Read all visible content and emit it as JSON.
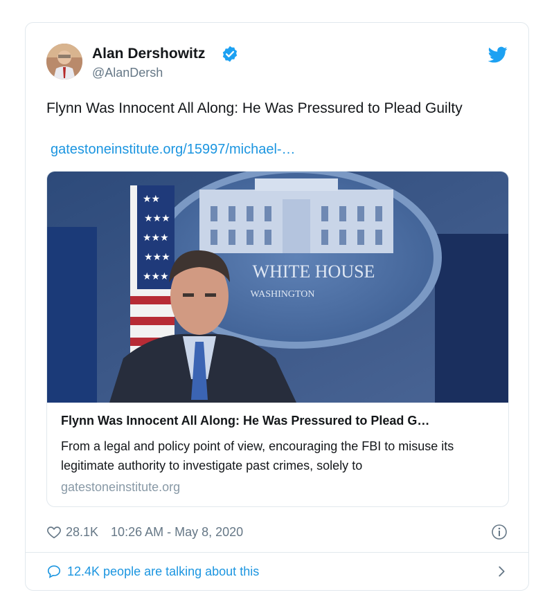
{
  "tweet": {
    "author": {
      "name": "Alan Dershowitz",
      "handle": "@AlanDersh",
      "verified_icon": "verified-badge-icon",
      "avatar": "avatar"
    },
    "text": "Flynn Was Innocent All Along: He Was Pressured to Plead Guilty",
    "link": "gatestoneinstitute.org/15997/michael-…",
    "card": {
      "image_caption_text": [
        "WHITE HOUSE",
        "WASHINGTON"
      ],
      "title": "Flynn Was Innocent All Along: He Was Pressured to Plead G…",
      "description": "From a legal and policy point of view, encouraging the FBI to misuse its legitimate authority to investigate past crimes, solely to",
      "domain": "gatestoneinstitute.org"
    },
    "likes": "28.1K",
    "timestamp": "10:26 AM - May 8, 2020",
    "talking": "12.4K people are talking about this"
  },
  "icons": {
    "bird": "twitter-bird-icon",
    "heart": "heart-icon",
    "info": "info-icon",
    "bubble": "speech-bubble-icon",
    "chevron": "chevron-right-icon"
  },
  "colors": {
    "twitter_blue": "#1da1f2",
    "link_blue": "#1b95e0",
    "muted_gray": "#657786",
    "domain_gray": "#8899a6",
    "border": "#e1e8ed"
  }
}
